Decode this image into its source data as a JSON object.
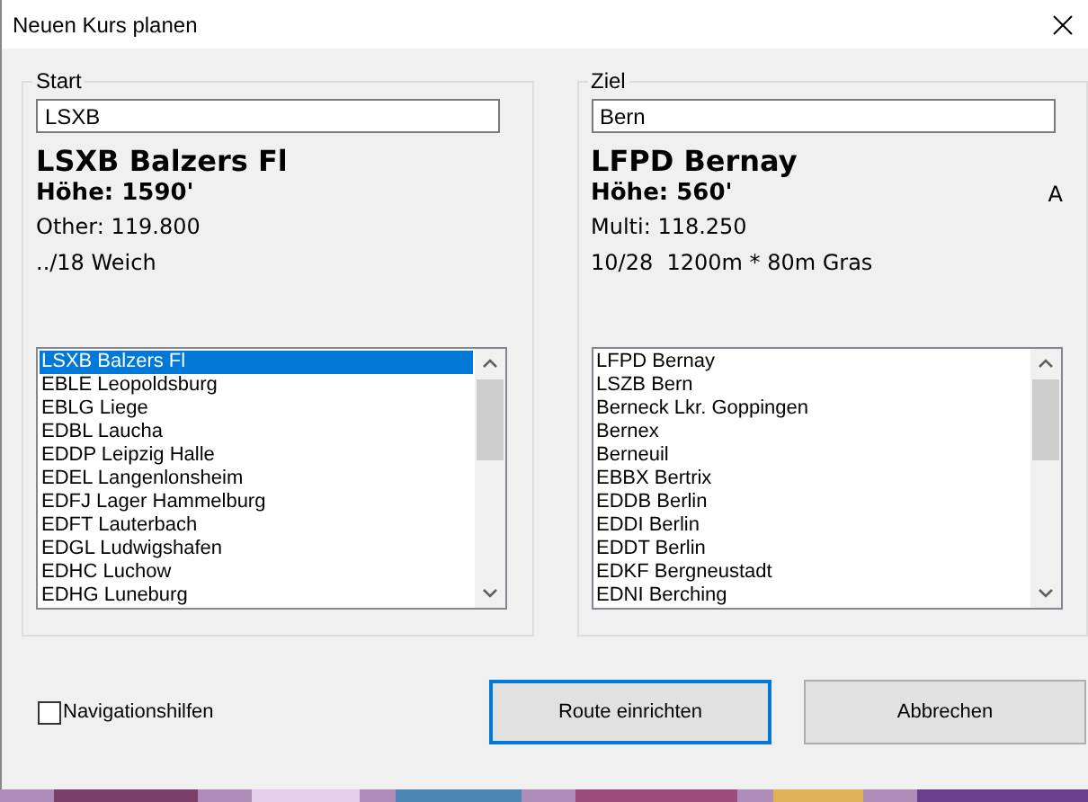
{
  "window": {
    "title": "Neuen Kurs planen"
  },
  "panels": [
    {
      "title": "Start",
      "search": {
        "value": "LSXB"
      },
      "name": "LSXB Balzers Fl",
      "elevation": "Höhe: 1590'",
      "frequency": "Other: 119.800",
      "runway": "../18 Weich",
      "items": [
        {
          "label": "LSXB Balzers Fl",
          "selected": true
        },
        {
          "label": "EBLE Leopoldsburg",
          "selected": false
        },
        {
          "label": "EBLG Liege",
          "selected": false
        },
        {
          "label": "EDBL Laucha",
          "selected": false
        },
        {
          "label": "EDDP Leipzig Halle",
          "selected": false
        },
        {
          "label": "EDEL Langenlonsheim",
          "selected": false
        },
        {
          "label": "EDFJ Lager Hammelburg",
          "selected": false
        },
        {
          "label": "EDFT Lauterbach",
          "selected": false
        },
        {
          "label": "EDGL Ludwigshafen",
          "selected": false
        },
        {
          "label": "EDHC Luchow",
          "selected": false
        },
        {
          "label": "EDHG Luneburg",
          "selected": false
        }
      ]
    },
    {
      "title": "Ziel",
      "search": {
        "value": "Bern"
      },
      "name": "LFPD Bernay",
      "elevation": "Höhe: 560'",
      "flag": "A",
      "frequency": "Multi: 118.250",
      "runway": "10/28  1200m * 80m Gras",
      "items": [
        {
          "label": "LFPD Bernay",
          "selected": false
        },
        {
          "label": "LSZB Bern",
          "selected": false
        },
        {
          "label": "Berneck Lkr. Goppingen",
          "selected": false
        },
        {
          "label": "Bernex",
          "selected": false
        },
        {
          "label": "Berneuil",
          "selected": false
        },
        {
          "label": "EBBX Bertrix",
          "selected": false
        },
        {
          "label": "EDDB Berlin",
          "selected": false
        },
        {
          "label": "EDDI Berlin",
          "selected": false
        },
        {
          "label": "EDDT Berlin",
          "selected": false
        },
        {
          "label": "EDKF Bergneustadt",
          "selected": false
        },
        {
          "label": "EDNI Berching",
          "selected": false
        }
      ]
    }
  ],
  "navigation_aids": {
    "label": "Navigationshilfen",
    "checked": false
  },
  "buttons": [
    {
      "label": "Route einrichten",
      "selected": true
    },
    {
      "label": "Abbrechen",
      "selected": false
    }
  ]
}
